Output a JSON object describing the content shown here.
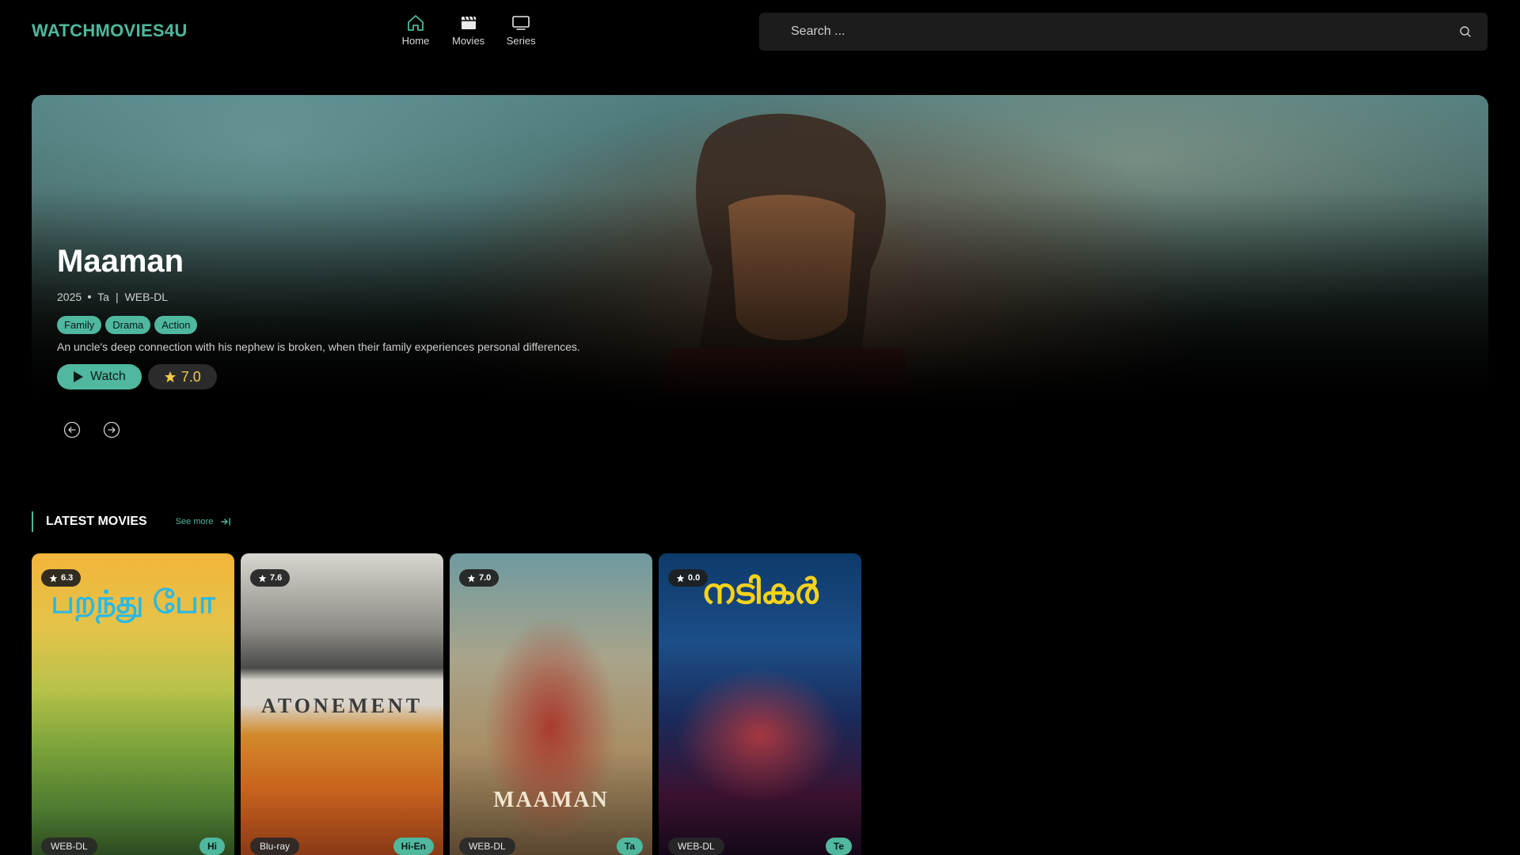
{
  "app": {
    "logo": "WATCHMOVIES4U",
    "accent_color": "#4fb89e"
  },
  "nav": {
    "items": [
      {
        "label": "Home",
        "icon": "home-icon",
        "active": true
      },
      {
        "label": "Movies",
        "icon": "clapperboard-icon"
      },
      {
        "label": "Series",
        "icon": "tv-icon"
      }
    ]
  },
  "search": {
    "placeholder": "Search ...",
    "value": "",
    "icon": "search-icon"
  },
  "hero": {
    "title": "Maaman",
    "year": "2025",
    "language": "Ta",
    "separator": "|",
    "quality": "WEB-DL",
    "genres": [
      "Family",
      "Drama",
      "Action"
    ],
    "description": "An uncle's deep connection with his nephew is broken, when their family experiences personal differences.",
    "watch_label": "Watch",
    "rating": "7.0"
  },
  "carousel": {
    "prev_icon": "arrow-left-circle-icon",
    "next_icon": "arrow-right-circle-icon"
  },
  "latest": {
    "title": "LATEST MOVIES",
    "see_more": "See more",
    "cards": [
      {
        "rating": "6.3",
        "quality": "WEB-DL",
        "lang": "Hi",
        "poster_text": "பறந்து போ"
      },
      {
        "rating": "7.6",
        "quality": "Blu-ray",
        "lang": "Hi-En",
        "poster_text": "ATONEMENT"
      },
      {
        "rating": "7.0",
        "quality": "WEB-DL",
        "lang": "Ta",
        "poster_text": "MAAMAN"
      },
      {
        "rating": "0.0",
        "quality": "WEB-DL",
        "lang": "Te",
        "poster_text": "നടികർ"
      }
    ]
  }
}
